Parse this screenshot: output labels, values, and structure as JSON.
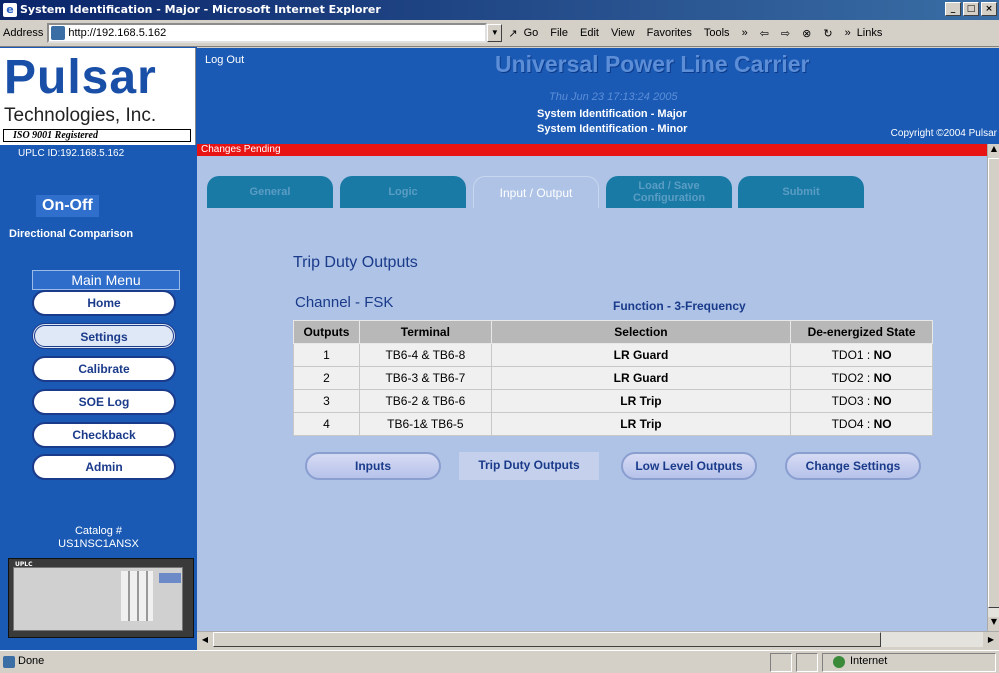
{
  "window": {
    "title": "System Identification - Major - Microsoft Internet Explorer"
  },
  "toolbar": {
    "address_label": "Address",
    "url": "http://192.168.5.162",
    "go": "Go",
    "menus": [
      "File",
      "Edit",
      "View",
      "Favorites",
      "Tools"
    ],
    "more": "»",
    "links": "Links"
  },
  "header": {
    "logo_big": "Pulsar",
    "logo_tech": "Technologies, Inc.",
    "logo_iso": "ISO 9001 Registered",
    "logout": "Log Out",
    "title": "Universal Power Line Carrier",
    "datetime": "Thu Jun 23 17:13:24 2005",
    "sys_major": "System Identification - Major",
    "sys_minor": "System Identification - Minor",
    "copyright": "Copyright ©2004 Pulsar"
  },
  "sidebar": {
    "uplc_id": "UPLC ID:192.168.5.162",
    "mode": "On-Off",
    "scheme": "Directional Comparison",
    "menu_header": "Main Menu",
    "items": [
      {
        "label": "Home"
      },
      {
        "label": "Settings"
      },
      {
        "label": "Calibrate"
      },
      {
        "label": "SOE Log"
      },
      {
        "label": "Checkback"
      },
      {
        "label": "Admin"
      }
    ],
    "catalog_label": "Catalog #",
    "catalog_number": "US1NSC1ANSX"
  },
  "status_banner": "Changes Pending",
  "tabs": [
    {
      "label": "General"
    },
    {
      "label": "Logic"
    },
    {
      "label": "Input / Output"
    },
    {
      "label": "Load / Save",
      "label2": "Configuration"
    },
    {
      "label": "Submit"
    }
  ],
  "main": {
    "title": "Trip Duty Outputs",
    "channel": "Channel - FSK",
    "function": "Function - 3-Frequency",
    "columns": [
      "Outputs",
      "Terminal",
      "Selection",
      "De-energized State"
    ],
    "rows": [
      {
        "output": "1",
        "terminal": "TB6-4 & TB6-8",
        "selection": "LR Guard",
        "state_pre": "TDO1 :",
        "state_val": "NO"
      },
      {
        "output": "2",
        "terminal": "TB6-3 & TB6-7",
        "selection": "LR Guard",
        "state_pre": "TDO2 :",
        "state_val": "NO"
      },
      {
        "output": "3",
        "terminal": "TB6-2 & TB6-6",
        "selection": "LR Trip",
        "state_pre": "TDO3 :",
        "state_val": "NO"
      },
      {
        "output": "4",
        "terminal": "TB6-1& TB6-5",
        "selection": "LR Trip",
        "state_pre": "TDO4 :",
        "state_val": "NO"
      }
    ],
    "buttons": [
      "Inputs",
      "Trip Duty Outputs",
      "Low Level Outputs",
      "Change Settings"
    ]
  },
  "statusbar": {
    "left": "Done",
    "zone": "Internet"
  }
}
